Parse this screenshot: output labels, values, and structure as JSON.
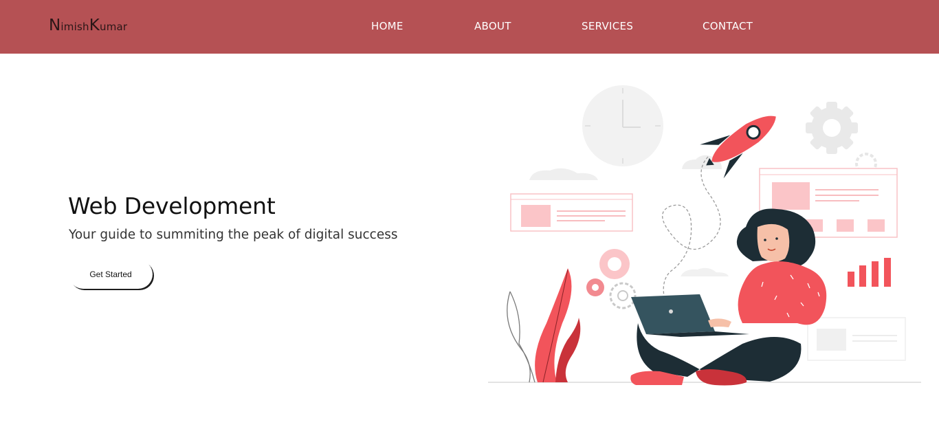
{
  "header": {
    "logo": {
      "first_initial": "N",
      "first_rest": "imish",
      "last_initial": "K",
      "last_rest": "umar"
    },
    "nav": [
      {
        "label": "HOME"
      },
      {
        "label": "ABOUT"
      },
      {
        "label": "SERVICES"
      },
      {
        "label": "CONTACT"
      }
    ]
  },
  "hero": {
    "title": "Web Development",
    "subtitle": "Your guide to summiting the peak of digital success",
    "button_label": "Get Started"
  },
  "illustration": {
    "icons": [
      "clock-icon",
      "rocket-icon",
      "gear-icon",
      "browser-window-icon",
      "bar-chart-icon",
      "plant-icon",
      "laptop-icon",
      "person-figure"
    ]
  },
  "colors": {
    "header_bg": "#b55154",
    "accent_red": "#f2545b",
    "dark_navy": "#1d2d35",
    "light_pink": "#fbc5c8"
  }
}
